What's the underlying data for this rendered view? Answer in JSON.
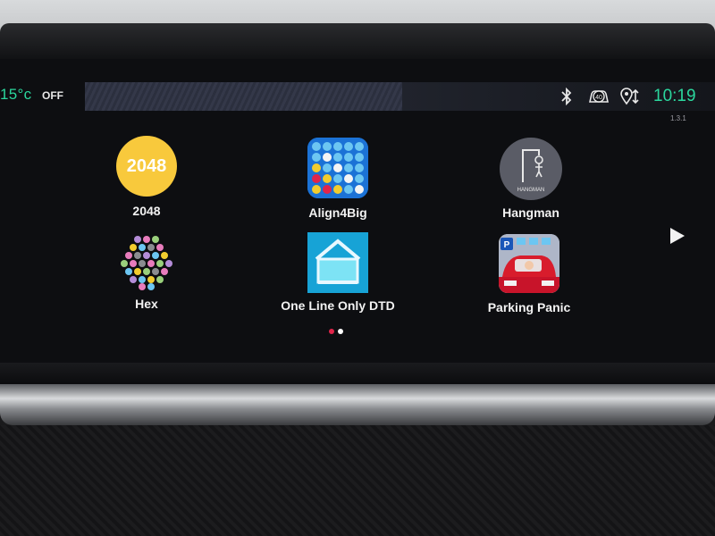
{
  "status": {
    "temperature": "15°c",
    "ac_state": "OFF",
    "time": "10:19",
    "version": "1.3.1",
    "icons": [
      "bluetooth-icon",
      "speed-limit-icon",
      "navigation-icon"
    ],
    "speed_limit": "40"
  },
  "apps": [
    {
      "name": "2048",
      "icon_text": "2048"
    },
    {
      "name": "Align4Big"
    },
    {
      "name": "Hangman",
      "icon_text": "HANGMAN"
    },
    {
      "name": "Hex"
    },
    {
      "name": "One Line Only DTD"
    },
    {
      "name": "Parking Panic"
    }
  ],
  "pagination": {
    "current": 1,
    "total": 2
  },
  "colors": {
    "accent": "#2bd79d",
    "active_dot": "#e0254a",
    "inactive_dot": "#ffffff"
  }
}
